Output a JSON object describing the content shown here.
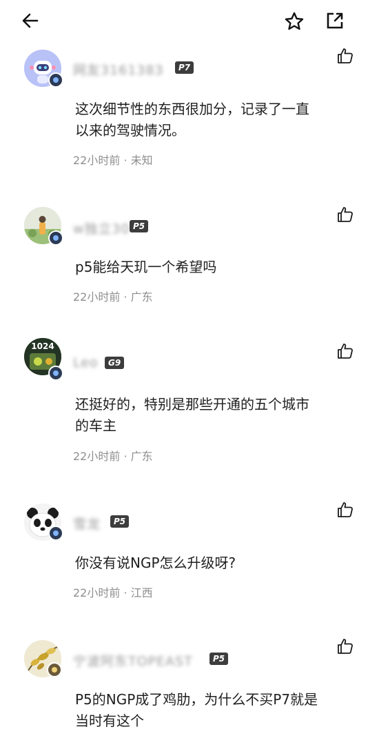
{
  "header": {
    "back_icon": "arrow-left-icon",
    "favorite_icon": "star-outline-icon",
    "share_icon": "share-external-icon"
  },
  "comments": [
    {
      "username": "网友3161383",
      "level": "P7",
      "text_line1": "这次细节性的东西很加分，记录了一直",
      "text_line2": "以来的驾驶情况。",
      "meta": "22小时前 · 未知"
    },
    {
      "username": "w独立30",
      "level": "P5",
      "text_line1": "p5能给天玑一个希望吗",
      "text_line2": "",
      "meta": "22小时前 · 广东"
    },
    {
      "username": "Leo",
      "level": "G9",
      "text_line1": "还挺好的，特别是那些开通的五个城市",
      "text_line2": "的车主",
      "meta": "22小时前 · 广东"
    },
    {
      "username": "雪龙",
      "level": "P5",
      "text_line1": "你没有说NGP怎么升级呀?",
      "text_line2": "",
      "meta": "22小时前 · 江西"
    },
    {
      "username": "宁波阿东TOPEAST",
      "level": "P5",
      "text_line1": "P5的NGP成了鸡肋，为什么不买P7就是",
      "text_line2": "当时有这个",
      "meta": ""
    }
  ]
}
